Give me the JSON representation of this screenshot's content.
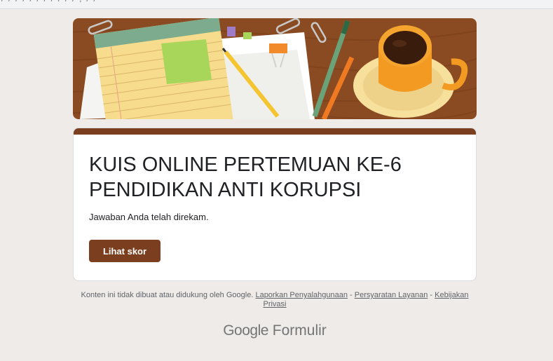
{
  "browser": {
    "address_fragment": "/ / / / / /    /    /  /   /    /    ,    /    /"
  },
  "form": {
    "title": "KUIS ONLINE PERTEMUAN KE-6 PENDIDIKAN ANTI KORUPSI",
    "confirmation": "Jawaban Anda telah direkam.",
    "score_button": "Lihat skor",
    "accent_color": "#7b3e1e",
    "background_color": "#efebe9"
  },
  "footer": {
    "disclaimer": "Konten ini tidak dibuat atau didukung oleh Google.",
    "links": [
      {
        "label": "Laporkan Penyalahgunaan"
      },
      {
        "label": "Persyaratan Layanan"
      },
      {
        "label": "Kebijakan Privasi"
      }
    ],
    "separator": "-"
  },
  "branding": {
    "google": "Google",
    "product": "Formulir"
  }
}
